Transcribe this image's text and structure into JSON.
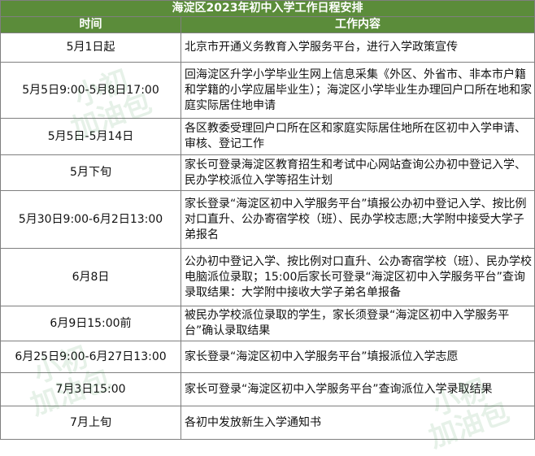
{
  "table": {
    "title": "海淀区2023年初中入学工作日程安排",
    "headers": {
      "time": "时间",
      "content": "工作内容"
    },
    "rows": [
      {
        "time": "5月1日起",
        "content": "北京市开通义务教育入学服务平台，进行入学政策宣传"
      },
      {
        "time": "5月5日9:00-5月8日17:00",
        "content": "回海淀区升学小学毕业生网上信息采集《外区、外省市、非本市户籍和学籍的小学应届毕业生）；海淀区小学毕业生办理回户口所在地和家庭实际居住地申请"
      },
      {
        "time": "5月5日-5月14日",
        "content": "各区教委受理回户口所在区和家庭实际居住地所在区初中入学申请、审核、登记工作"
      },
      {
        "time": "5月下旬",
        "content": "家长可登录海淀区教育招生和考试中心网站查询公办初中登记入学、民办学校派位入学等招生计划"
      },
      {
        "time": "5月30日9:00-6月2日13:00",
        "content": "家长登录“海淀区初中入学服务平台”填报公办初中登记入学、按比例对口直升、公办寄宿学校（班）、民办学校志愿;大学附中接受大学子弟报名"
      },
      {
        "time": "6月8日",
        "content": "公办初中登记入学、按比例对口直升、公办寄宿学校（班）、民办学校电脑派位录取；15:00后家长可登录“海淀区初中入学服务平台”查询录取结果：大学附中接收大学子弟名单报备"
      },
      {
        "time": "6月9日15:00前",
        "content": "被民办学校派位录取的学生，家长须登录“海淀区初中入学服务平台”确认录取结果"
      },
      {
        "time": "6月25日9:00-6月27日13:00",
        "content": "家长登录“海淀区初中入学服务平台”填报派位入学志愿"
      },
      {
        "time": "7月3日15:00",
        "content": "家长可登录“海淀区初中入学服务平台”查询派位入学录取结果"
      },
      {
        "time": "7月上旬",
        "content": "各初中发放新生入学通知书"
      }
    ]
  },
  "watermark": {
    "line1": "小初",
    "line2": "加油包"
  }
}
